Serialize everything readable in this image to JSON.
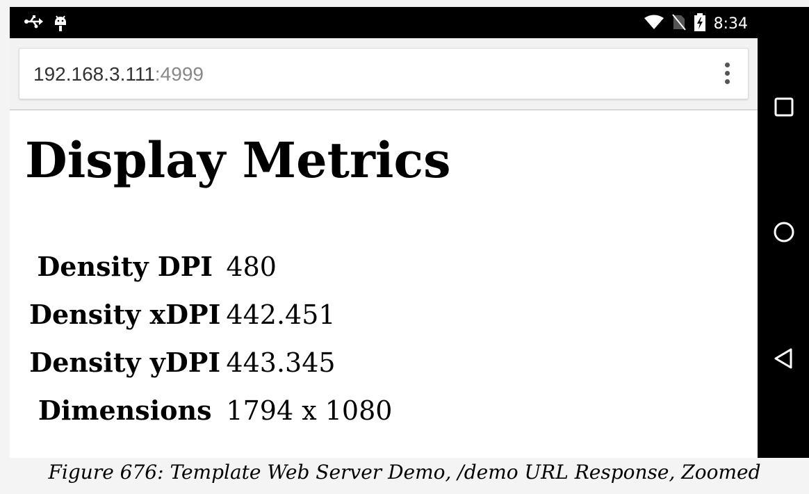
{
  "status_bar": {
    "time": "8:34",
    "left_icons": [
      "usb-icon",
      "android-debug-icon"
    ],
    "right_icons": [
      "wifi-icon",
      "no-sim-icon",
      "battery-charging-icon"
    ]
  },
  "browser": {
    "url_host": "192.168.3.111",
    "url_port": ":4999",
    "menu_icon": "overflow-menu-icon"
  },
  "page": {
    "title": "Display Metrics",
    "rows": [
      {
        "label": "Density DPI",
        "value": "480"
      },
      {
        "label": "Density xDPI",
        "value": "442.451"
      },
      {
        "label": "Density yDPI",
        "value": "443.345"
      },
      {
        "label": "Dimensions",
        "value": "1794 x 1080"
      }
    ]
  },
  "nav_bar": {
    "buttons": [
      "recents-icon",
      "home-icon",
      "back-icon"
    ]
  },
  "caption": "Figure 676: Template Web Server Demo, /demo URL Response, Zoomed",
  "colors": {
    "system_bar": "#000000",
    "chrome_background": "#f2f2f2",
    "url_port": "#888888"
  }
}
